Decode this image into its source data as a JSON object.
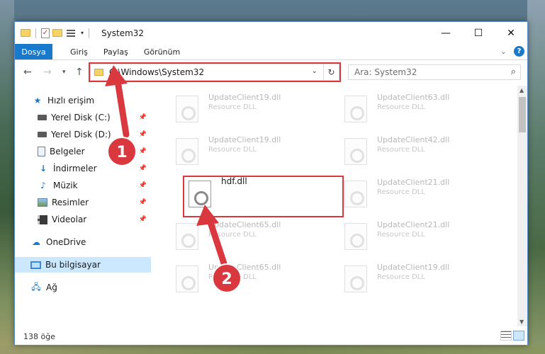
{
  "window": {
    "title": "System32",
    "controls": {
      "minimize": "—",
      "maximize": "☐",
      "close": "✕"
    }
  },
  "ribbon": {
    "file_tab": "Dosya",
    "tabs": [
      "Giriş",
      "Paylaş",
      "Görünüm"
    ],
    "help": "?"
  },
  "nav": {
    "address": "C:\\Windows\\System32",
    "search_placeholder": "Ara: System32"
  },
  "sidebar": {
    "items": [
      {
        "label": "Hızlı erişim",
        "icon": "star-icon"
      },
      {
        "label": "Yerel Disk (C:)",
        "icon": "drive-icon"
      },
      {
        "label": "Yerel Disk (D:)",
        "icon": "drive-icon"
      },
      {
        "label": "Belgeler",
        "icon": "documents-icon"
      },
      {
        "label": "İndirmeler",
        "icon": "downloads-icon"
      },
      {
        "label": "Müzik",
        "icon": "music-icon"
      },
      {
        "label": "Resimler",
        "icon": "pictures-icon"
      },
      {
        "label": "Videolar",
        "icon": "videos-icon"
      },
      {
        "label": "OneDrive",
        "icon": "cloud-icon"
      },
      {
        "label": "Bu bilgisayar",
        "icon": "computer-icon"
      },
      {
        "label": "Ağ",
        "icon": "network-icon"
      }
    ],
    "selected": "Bu bilgisayar"
  },
  "files": {
    "left": [
      {
        "name": "UpdateClient19.dll",
        "type": "Resource DLL"
      },
      {
        "name": "UpdateClient19.dll",
        "type": "Resource DLL"
      },
      {
        "name": "hdf.dll",
        "type": ""
      },
      {
        "name": "UpdateClient65.dll",
        "type": "Resource DLL"
      },
      {
        "name": "UpdateClient65.dll",
        "type": "Resource DLL"
      }
    ],
    "right": [
      {
        "name": "UpdateClient63.dll",
        "type": "Resource DLL"
      },
      {
        "name": "UpdateClient42.dll",
        "type": "Resource DLL"
      },
      {
        "name": "UpdateClient21.dll",
        "type": "Resource DLL"
      },
      {
        "name": "UpdateClient21.dll",
        "type": "Resource DLL"
      },
      {
        "name": "UpdateClient19.dll",
        "type": "Resource DLL"
      }
    ]
  },
  "status": {
    "count": "138 öğe"
  },
  "annotations": {
    "step1": "1",
    "step2": "2",
    "color": "#d9383f"
  }
}
